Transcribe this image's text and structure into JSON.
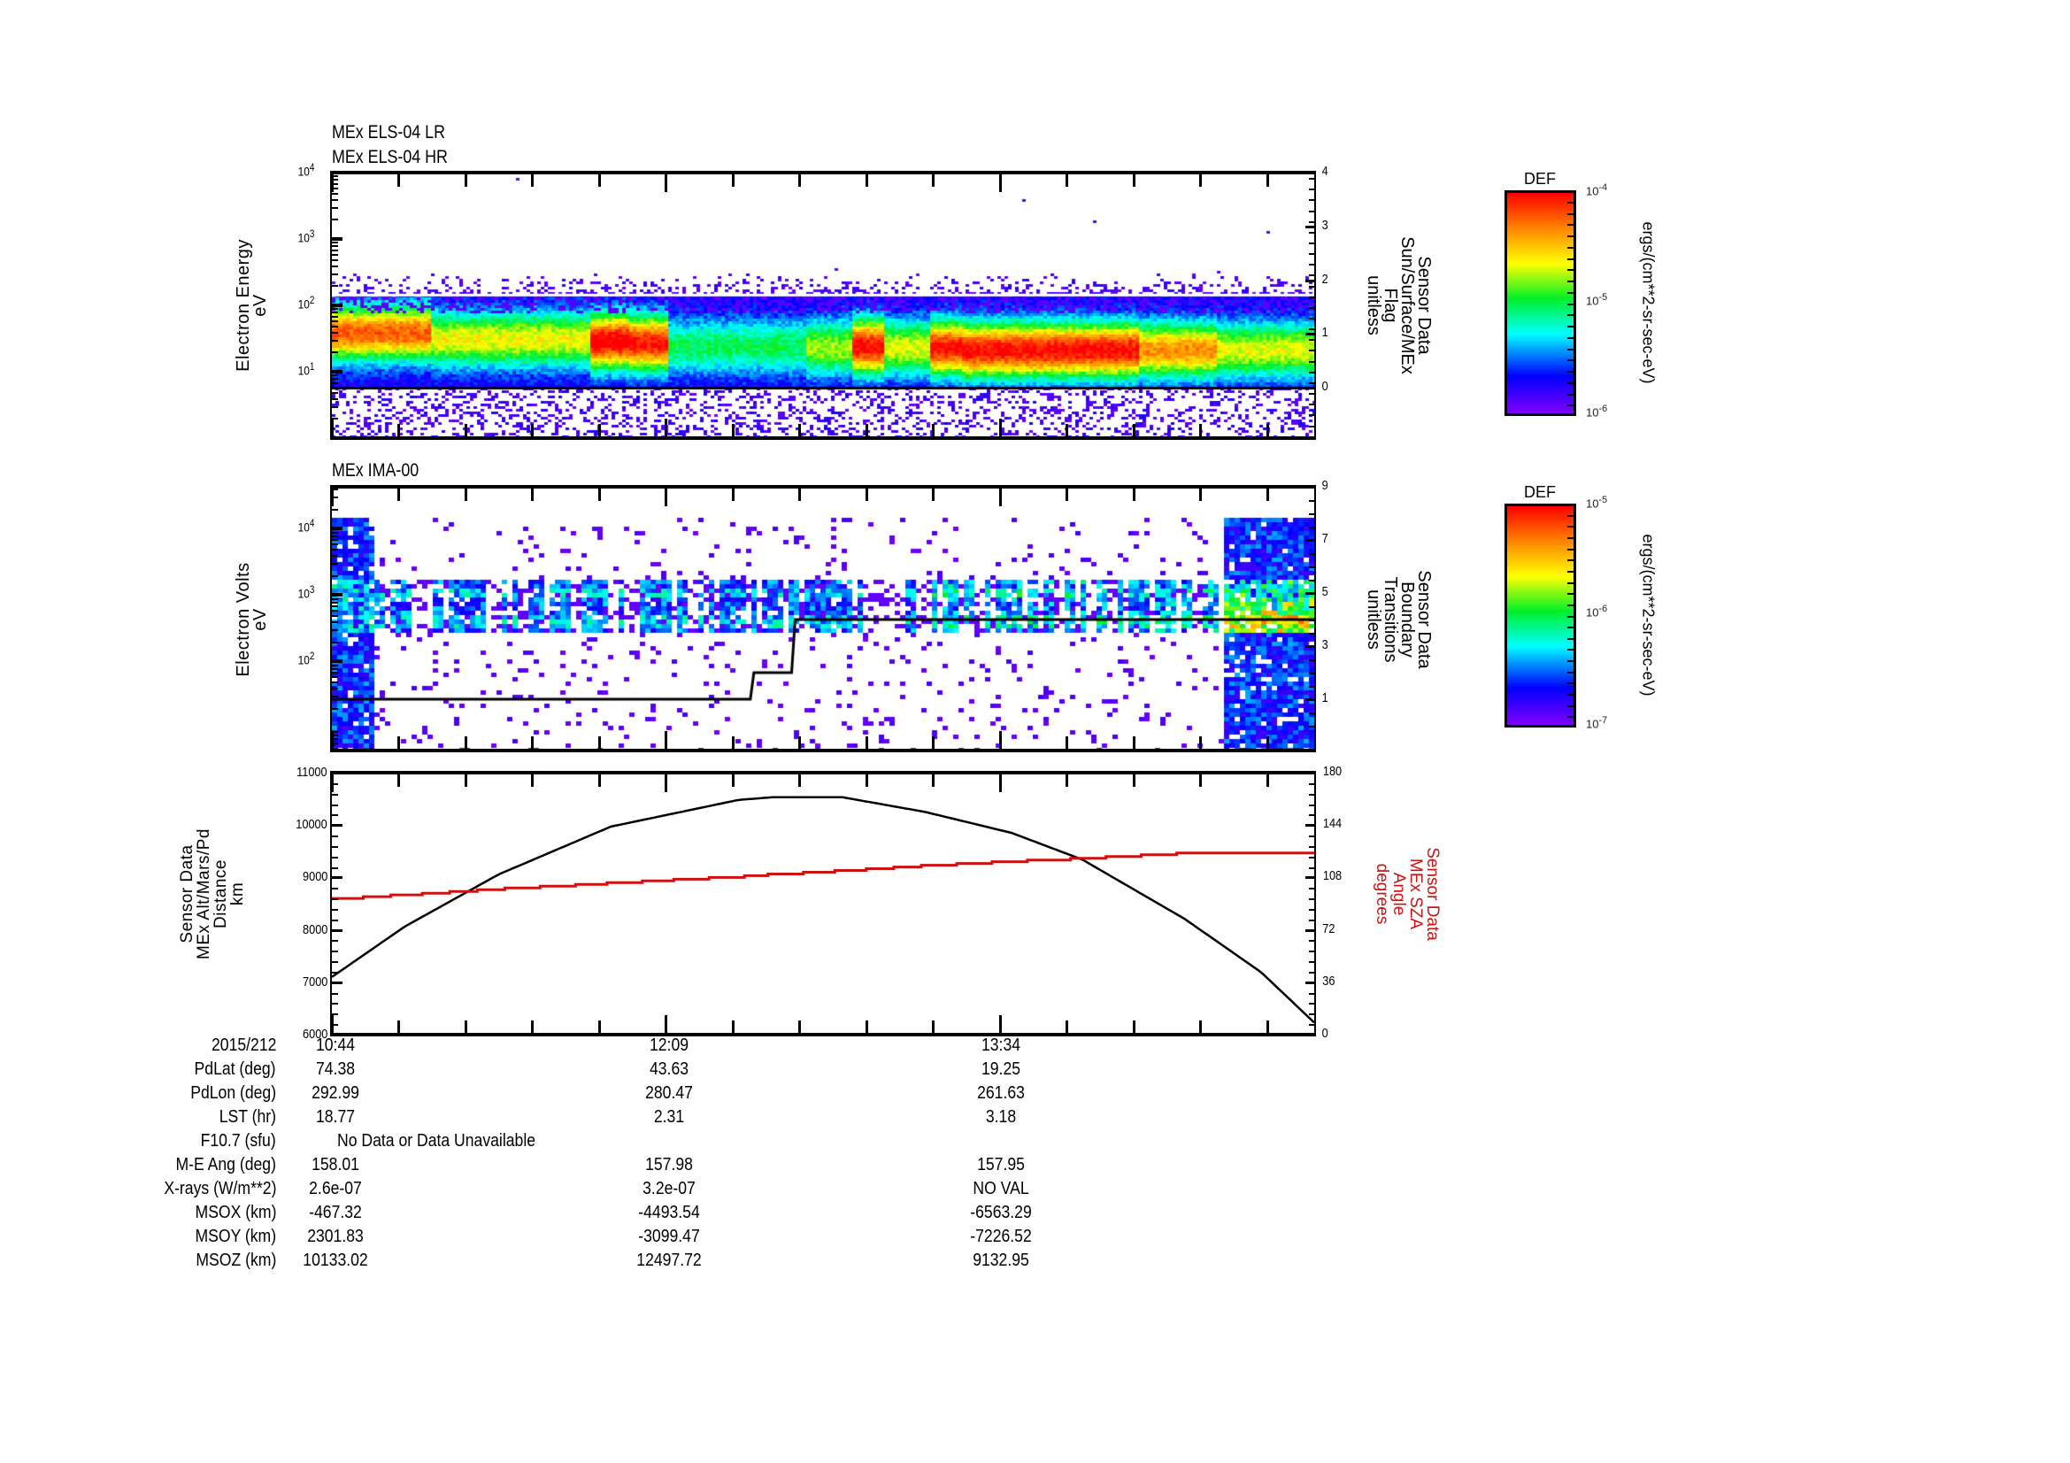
{
  "chart_data": [
    {
      "type": "heatmap",
      "titles": [
        "MEx ELS-04 LR",
        "MEx ELS-04 HR"
      ],
      "ylabel": "Electron Energy\neV",
      "yscale": "log",
      "ylim": [
        1,
        10000
      ],
      "yticks": [
        {
          "exp": "1"
        },
        {
          "exp": "2"
        },
        {
          "exp": "3"
        },
        {
          "exp": "4"
        }
      ],
      "y2label": "Sensor Data\nSun/Surface/MEx\nFlag\nunitless",
      "y2lim": [
        0,
        4
      ],
      "y2ticks": [
        "0",
        "1",
        "2",
        "3",
        "4"
      ],
      "flag_value": 0,
      "hr_boundary_ev": 145,
      "band_ev": [
        6,
        145
      ],
      "segments_minutes": [
        {
          "from": 0,
          "to": 25,
          "peak_ev": 40,
          "level": 0.82
        },
        {
          "from": 25,
          "to": 65,
          "peak_ev": 32,
          "level": 0.62
        },
        {
          "from": 65,
          "to": 75,
          "peak_ev": 30,
          "level": 0.96
        },
        {
          "from": 75,
          "to": 85,
          "peak_ev": 28,
          "level": 0.92
        },
        {
          "from": 85,
          "to": 120,
          "peak_ev": 25,
          "level": 0.42
        },
        {
          "from": 120,
          "to": 132,
          "peak_ev": 24,
          "level": 0.55
        },
        {
          "from": 132,
          "to": 140,
          "peak_ev": 25,
          "level": 0.93
        },
        {
          "from": 140,
          "to": 152,
          "peak_ev": 24,
          "level": 0.6
        },
        {
          "from": 152,
          "to": 160,
          "peak_ev": 24,
          "level": 0.92
        },
        {
          "from": 160,
          "to": 205,
          "peak_ev": 22,
          "level": 0.93
        },
        {
          "from": 205,
          "to": 225,
          "peak_ev": 22,
          "level": 0.76
        },
        {
          "from": 225,
          "to": 250,
          "peak_ev": 22,
          "level": 0.6
        }
      ],
      "colorbar": {
        "title": "DEF",
        "min_label_exp": "-6",
        "mid_label_exp": "-5",
        "max_label_exp": "-4",
        "units": "ergs/(cm**2-sr-sec-eV)"
      }
    },
    {
      "type": "heatmap",
      "title": "MEx IMA-00",
      "ylabel": "Electron Volts\neV",
      "yscale": "log",
      "ylim": [
        4.5,
        42000
      ],
      "yticks": [
        {
          "exp": "2"
        },
        {
          "exp": "3"
        },
        {
          "exp": "4"
        }
      ],
      "y2label": "Sensor Data\nBoundary\nTransitions\nunitless",
      "y2lim": [
        -0.93,
        9
      ],
      "y2ticks": [
        "1",
        "3",
        "5",
        "7",
        "9"
      ],
      "boundary_steps_minutes": [
        {
          "from": 0,
          "to": 106.5,
          "value": 1
        },
        {
          "from": 106.5,
          "to": 117,
          "value": 2
        },
        {
          "from": 117,
          "to": 250,
          "value": 4
        }
      ],
      "band_ev": [
        280,
        1800
      ],
      "dense_intervals_minutes": [
        [
          0,
          10
        ],
        [
          226,
          250
        ]
      ],
      "colorbar": {
        "title": "DEF",
        "min_label_exp": "-7",
        "mid_label_exp": "-6",
        "max_label_exp": "-5",
        "units": "ergs/(cm**2-sr-sec-eV)"
      }
    },
    {
      "type": "line",
      "ylabel": "Sensor Data\nMEx Alt/Mars/Pd\nDistance\nkm",
      "ylim": [
        6000,
        11000
      ],
      "yticks": [
        "6000",
        "7000",
        "8000",
        "9000",
        "10000",
        "11000"
      ],
      "y2label": "Sensor Data\nMEx SZA\nAngle\ndegrees",
      "y2lim": [
        0,
        180
      ],
      "y2ticks": [
        "0",
        "36",
        "72",
        "108",
        "144",
        "180"
      ],
      "x_minutes_from_start": [
        0,
        18.5,
        42.5,
        71,
        103.5,
        112,
        130,
        151,
        173,
        191,
        217,
        236.5,
        250
      ],
      "series": [
        {
          "name": "MEx Alt/Mars/Pd Distance",
          "color": "#000000",
          "values": [
            7100,
            8060,
            9060,
            9970,
            10480,
            10530,
            10530,
            10250,
            9850,
            9340,
            8210,
            7190,
            6230
          ]
        },
        {
          "name": "MEx SZA Angle",
          "color": "#cc1111",
          "values": [
            93,
            96,
            100,
            104,
            108.5,
            110,
            112.5,
            116,
            119,
            121,
            124.5,
            124.5,
            124.5
          ]
        }
      ]
    }
  ],
  "colors": {
    "sza": "#cc1111",
    "frame": "#000000"
  },
  "ephemeris": {
    "date": "2015/212",
    "times": [
      "10:44",
      "12:09",
      "13:34"
    ],
    "rows": [
      {
        "label": "PdLat (deg)",
        "values": [
          "74.38",
          "43.63",
          "19.25"
        ]
      },
      {
        "label": "PdLon (deg)",
        "values": [
          "292.99",
          "280.47",
          "261.63"
        ]
      },
      {
        "label": "LST (hr)",
        "values": [
          "18.77",
          "2.31",
          "3.18"
        ]
      },
      {
        "label": "F10.7 (sfu)",
        "note": "No Data or Data Unavailable"
      },
      {
        "label": "M-E Ang (deg)",
        "values": [
          "158.01",
          "157.98",
          "157.95"
        ]
      },
      {
        "label": "X-rays (W/m**2)",
        "values": [
          "2.6e-07",
          "3.2e-07",
          "NO VAL"
        ]
      },
      {
        "label": "MSOX (km)",
        "values": [
          "-467.32",
          "-4493.54",
          "-6563.29"
        ]
      },
      {
        "label": "MSOY (km)",
        "values": [
          "2301.83",
          "-3099.47",
          "-7226.52"
        ]
      },
      {
        "label": "MSOZ (km)",
        "values": [
          "10133.02",
          "12497.72",
          "9132.95"
        ]
      }
    ]
  }
}
